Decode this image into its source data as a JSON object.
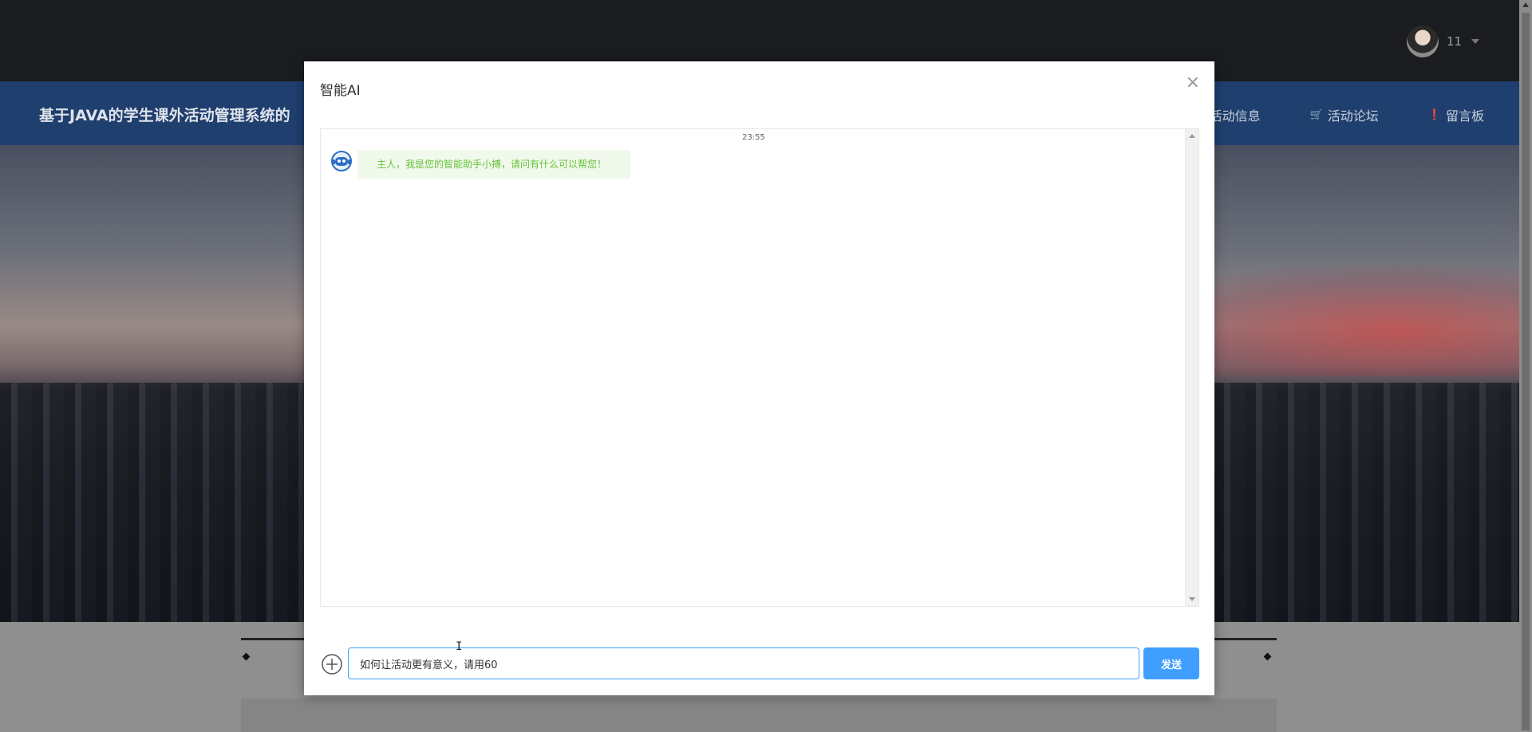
{
  "header": {
    "user_name": "11",
    "avatar_icon": "user-avatar",
    "caret_icon": "caret-down-icon"
  },
  "nav": {
    "site_title": "基于JAVA的学生课外活动管理系统的",
    "items": [
      {
        "label": "活动信息",
        "icon": ""
      },
      {
        "label": "活动论坛",
        "icon": "bag-icon"
      },
      {
        "label": "留言板",
        "icon": "info-icon"
      }
    ]
  },
  "modal": {
    "title": "智能AI",
    "close_icon": "close-icon",
    "chat": {
      "time": "23:55",
      "bot_message": "主人，我是您的智能助手小搏，请问有什么可以帮您！"
    },
    "input_value": "如何让活动更有意义，请用60",
    "send_label": "发送"
  },
  "colors": {
    "accent": "#409eff",
    "navbar": "#1f3f6e",
    "topbar": "#1a1c20",
    "bot_bubble_bg": "#f0f9eb",
    "bot_bubble_text": "#67c23a"
  }
}
